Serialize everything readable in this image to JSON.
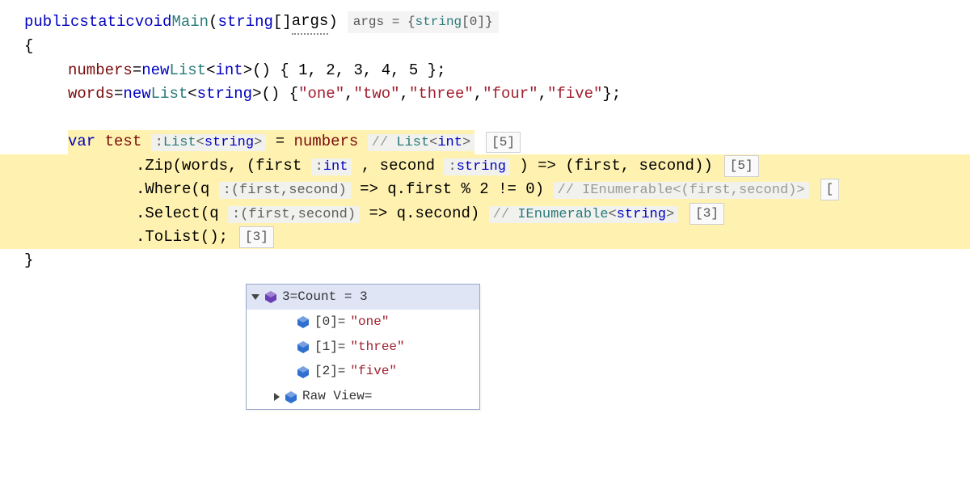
{
  "signature": {
    "kw_public": "public",
    "kw_static": "static",
    "kw_void": "void",
    "name": "Main",
    "param_type": "string",
    "param_name": "args",
    "debug_args_label": "args",
    "debug_args_value_prefix": "= {",
    "debug_args_type": "string",
    "debug_args_index": "[0]",
    "debug_args_suffix": "}"
  },
  "braces": {
    "open": "{",
    "close": "}"
  },
  "line_numbers": {
    "lhs": "numbers",
    "eq": " = ",
    "kw_new": "new",
    "type_list": "List",
    "type_arg": "int",
    "values": "() { 1, 2, 3, 4, 5 };"
  },
  "line_words": {
    "lhs": "words",
    "eq": " = ",
    "kw_new": "new",
    "type_list": "List",
    "type_arg": "string",
    "paren": "() { ",
    "items": [
      "\"one\"",
      "\"two\"",
      "\"three\"",
      "\"four\"",
      "\"five\""
    ],
    "sep": ", ",
    "end": " };"
  },
  "test": {
    "kw_var": "var",
    "varname": "test",
    "hint_label": ":",
    "hint_type1": "List",
    "hint_type2": "string",
    "eq": " = ",
    "rhs": "numbers",
    "comment_prefix": "// ",
    "comment_type1": "List",
    "comment_type2": "int",
    "badge": "[5]"
  },
  "zip": {
    "text1": ".Zip(words, (first",
    "hint1_label": ":",
    "hint1_type": "int",
    "text2": ", second",
    "hint2_label": ":",
    "hint2_type": "string",
    "text3": ") => (first, second))",
    "badge": "[5]"
  },
  "where": {
    "text1": ".Where(q",
    "hint_label": ":",
    "hint_tuple": "(first,second)",
    "text2": " => q.first % 2 != 0)",
    "comment": "// IEnumerable<(first,second)>",
    "badge": "["
  },
  "select": {
    "text1": ".Select(q",
    "hint_label": ":",
    "hint_tuple": "(first,second)",
    "text2": " => q.second)",
    "comment_prefix": "// ",
    "comment_type": "IEnumerable",
    "comment_arg": "string",
    "badge": "[3]"
  },
  "tolist": {
    "text": ".ToList();",
    "badge": "[3]"
  },
  "popup": {
    "header": "3=Count = 3",
    "rows": [
      {
        "key": "[0]=",
        "value": "\"one\""
      },
      {
        "key": "[1]=",
        "value": "\"three\""
      },
      {
        "key": "[2]=",
        "value": "\"five\""
      }
    ],
    "raw": "Raw View="
  }
}
